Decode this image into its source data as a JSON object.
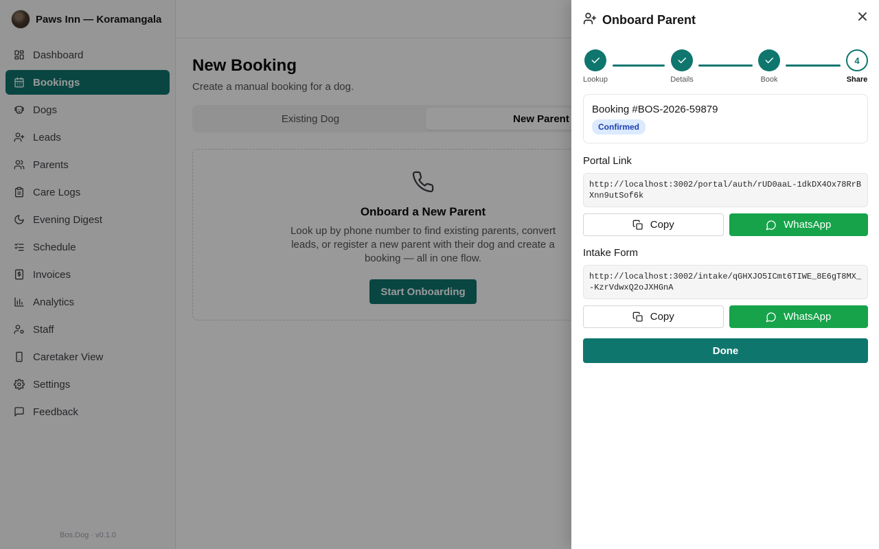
{
  "brand": {
    "name": "Paws Inn — Koramangala"
  },
  "sidebar": {
    "items": [
      {
        "label": "Dashboard",
        "icon": "dashboard-icon"
      },
      {
        "label": "Bookings",
        "icon": "calendar-icon",
        "active": true
      },
      {
        "label": "Dogs",
        "icon": "dog-icon"
      },
      {
        "label": "Leads",
        "icon": "user-plus-icon"
      },
      {
        "label": "Parents",
        "icon": "users-icon"
      },
      {
        "label": "Care Logs",
        "icon": "clipboard-icon"
      },
      {
        "label": "Evening Digest",
        "icon": "moon-icon"
      },
      {
        "label": "Schedule",
        "icon": "list-checks-icon"
      },
      {
        "label": "Invoices",
        "icon": "receipt-icon"
      },
      {
        "label": "Analytics",
        "icon": "bar-chart-icon"
      },
      {
        "label": "Staff",
        "icon": "user-cog-icon"
      },
      {
        "label": "Caretaker View",
        "icon": "smartphone-icon"
      },
      {
        "label": "Settings",
        "icon": "gear-icon"
      },
      {
        "label": "Feedback",
        "icon": "message-square-icon"
      }
    ],
    "footer": "Bos.Dog · v0.1.0"
  },
  "main": {
    "title": "New Booking",
    "subtitle": "Create a manual booking for a dog.",
    "tabs": [
      {
        "label": "Existing Dog",
        "active": false
      },
      {
        "label": "New Parent",
        "active": true
      }
    ],
    "empty": {
      "icon": "phone-icon",
      "title": "Onboard a New Parent",
      "description": "Look up by phone number to find existing parents, convert leads, or register a new parent with their dog and create a booking — all in one flow.",
      "button": "Start Onboarding"
    }
  },
  "drawer": {
    "title": "Onboard Parent",
    "steps": [
      {
        "label": "Lookup",
        "done": true
      },
      {
        "label": "Details",
        "done": true
      },
      {
        "label": "Book",
        "done": true
      },
      {
        "label": "Share",
        "number": "4",
        "current": true
      }
    ],
    "booking": {
      "id": "Booking #BOS-2026-59879",
      "status": "Confirmed"
    },
    "portal": {
      "label": "Portal Link",
      "url": "http://localhost:3002/portal/auth/rUD0aaL-1dkDX4Ox78RrBXnn9utSof6k",
      "copy": "Copy",
      "whatsapp": "WhatsApp"
    },
    "intake": {
      "label": "Intake Form",
      "url": "http://localhost:3002/intake/qGHXJO5ICmt6TIWE_8E6gT8MX_-KzrVdwxQ2oJXHGnA",
      "copy": "Copy",
      "whatsapp": "WhatsApp"
    },
    "done": "Done"
  },
  "colors": {
    "primary": "#0f766e",
    "whatsapp": "#16a34a",
    "badge_bg": "#dbeafe",
    "badge_text": "#1e40af"
  }
}
